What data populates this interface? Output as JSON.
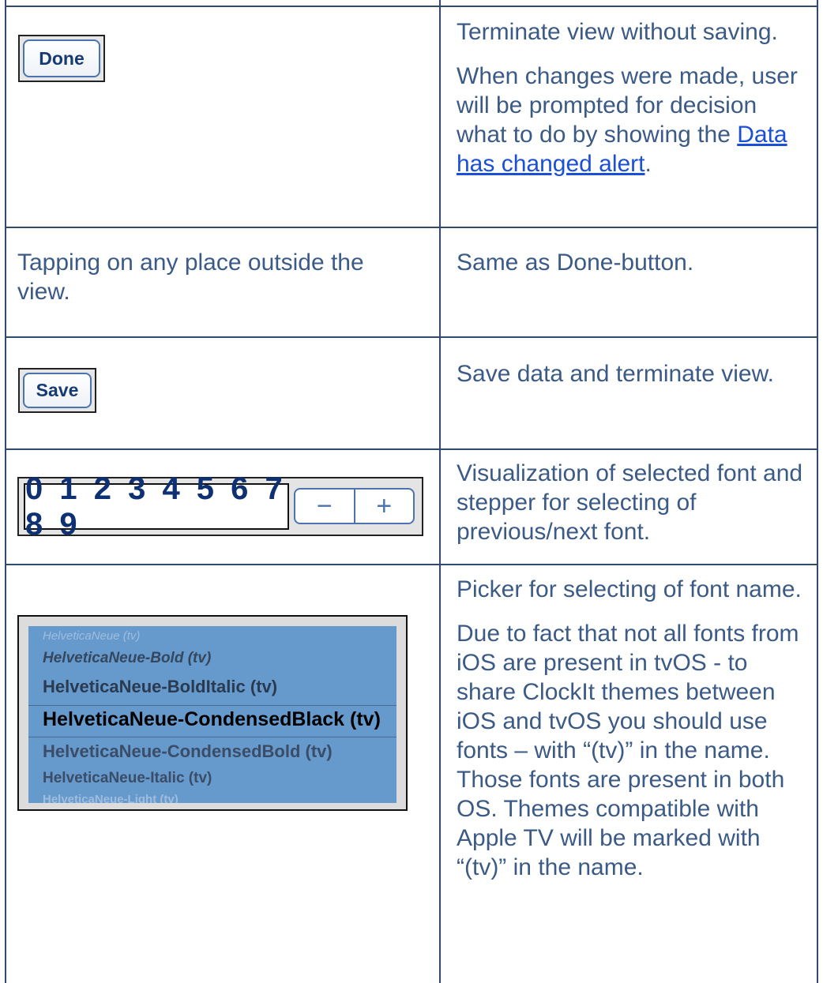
{
  "rows": [
    {
      "control": {
        "type": "button",
        "label": "Done"
      },
      "description": [
        {
          "text": "Terminate view without saving."
        },
        {
          "text_before": "When changes were made, user will be prompted for decision what to do by showing the ",
          "link": "Data has changed alert",
          "text_after": "."
        }
      ]
    },
    {
      "control": {
        "type": "text",
        "label": "Tapping on any place outside the view."
      },
      "description": [
        {
          "text": "Same as Done-button."
        }
      ]
    },
    {
      "control": {
        "type": "button",
        "label": "Save"
      },
      "description": [
        {
          "text": "Save data and terminate view."
        }
      ]
    },
    {
      "control": {
        "type": "font-preview-stepper",
        "digits": "0 1 2 3 4 5 6 7 8 9",
        "minus": "−",
        "plus": "+"
      },
      "description": [
        {
          "text": "Visualization of selected font and stepper for selecting of previous/next font."
        }
      ]
    },
    {
      "control": {
        "type": "picker",
        "items": [
          "HelveticaNeue (tv)",
          "HelveticaNeue-Bold (tv)",
          "HelveticaNeue-BoldItalic (tv)",
          "HelveticaNeue-CondensedBlack (tv)",
          "HelveticaNeue-CondensedBold (tv)",
          "HelveticaNeue-Italic (tv)",
          "HelveticaNeue-Light (tv)"
        ],
        "selected_index": 3
      },
      "description": [
        {
          "text": "Picker for selecting of font name."
        },
        {
          "text": "Due to fact that not all fonts from iOS are present in tvOS - to share ClockIt themes between iOS and tvOS you should use fonts – with “(tv)” in the name. Those fonts are present in both OS. Themes compatible with Apple TV will be marked with “(tv)” in the name."
        }
      ]
    }
  ],
  "colors": {
    "text": "#3b5a86",
    "link": "#1a4fd6",
    "border": "#2f4a6e",
    "button_text": "#163a73",
    "picker_bg": "#6699cc",
    "digits": "#0e3173"
  }
}
